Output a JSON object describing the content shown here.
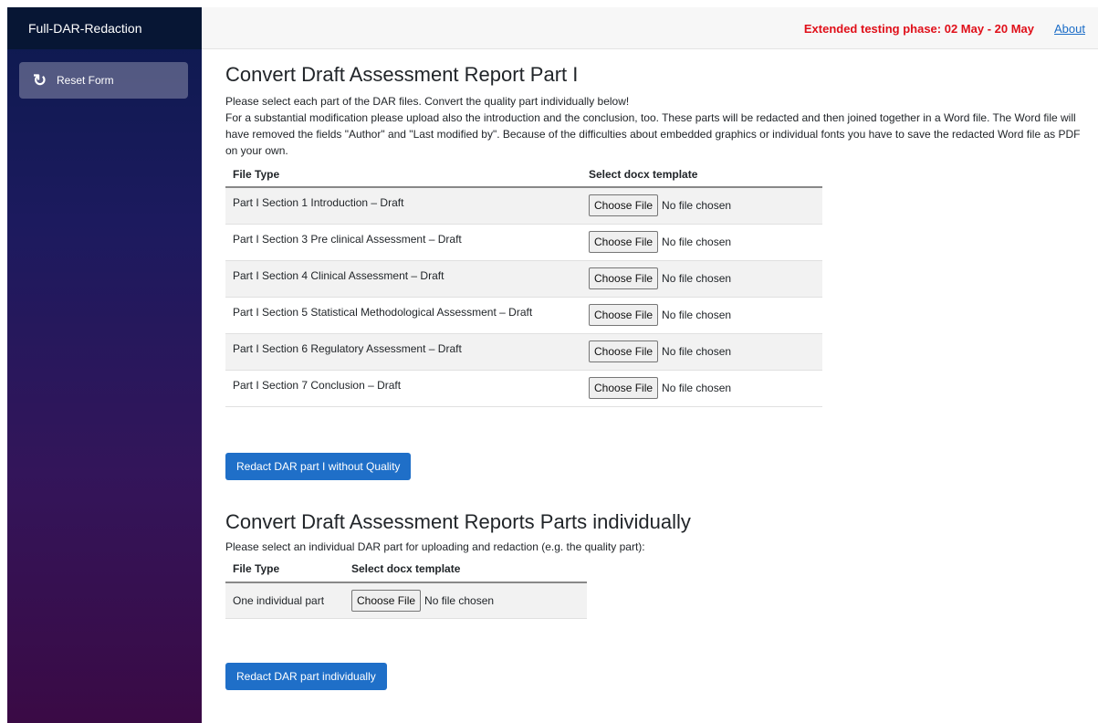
{
  "sidebar": {
    "app_title": "Full-DAR-Redaction",
    "reset_icon": "refresh-icon",
    "reset_label": "Reset Form"
  },
  "topbar": {
    "notice": "Extended testing phase: 02 May - 20 May",
    "about_link": "About",
    "notice_color": "#e0101a"
  },
  "section1": {
    "title": "Convert Draft Assessment Report Part I",
    "paragraph1": "Please select each part of the DAR files. Convert the quality part individually below!",
    "paragraph2": "For a substantial modification please upload also the introduction and the conclusion, too. These parts will be redacted and then joined together in a Word file. The Word file will have removed the fields \"Author\" and \"Last modified by\". Because of the difficulties about embedded graphics or individual fonts you have to save the redacted Word file as PDF on your own.",
    "columns": [
      "File Type",
      "Select docx template"
    ],
    "rows": [
      {
        "file_type": "Part I Section 1 Introduction – Draft",
        "button": "Choose File",
        "status": "No file chosen"
      },
      {
        "file_type": "Part I Section 3 Pre clinical Assessment – Draft",
        "button": "Choose File",
        "status": "No file chosen"
      },
      {
        "file_type": "Part I Section 4 Clinical Assessment – Draft",
        "button": "Choose File",
        "status": "No file chosen"
      },
      {
        "file_type": "Part I Section 5 Statistical Methodological Assessment – Draft",
        "button": "Choose File",
        "status": "No file chosen"
      },
      {
        "file_type": "Part I Section 6 Regulatory Assessment – Draft",
        "button": "Choose File",
        "status": "No file chosen"
      },
      {
        "file_type": "Part I Section 7 Conclusion – Draft",
        "button": "Choose File",
        "status": "No file chosen"
      }
    ],
    "submit_label": "Redact DAR part I without Quality"
  },
  "section2": {
    "title": "Convert Draft Assessment Reports Parts individually",
    "paragraph": "Please select an individual DAR part for uploading and redaction (e.g. the quality part):",
    "columns": [
      "File Type",
      "Select docx template"
    ],
    "rows": [
      {
        "file_type": "One individual part",
        "button": "Choose File",
        "status": "No file chosen"
      }
    ],
    "submit_label": "Redact DAR part individually"
  },
  "colors": {
    "primary": "#1f6fc8",
    "sidebar_top": "#071634",
    "sidebar_gradient_start": "#0c1a4e",
    "sidebar_gradient_end": "#3a0a45"
  }
}
